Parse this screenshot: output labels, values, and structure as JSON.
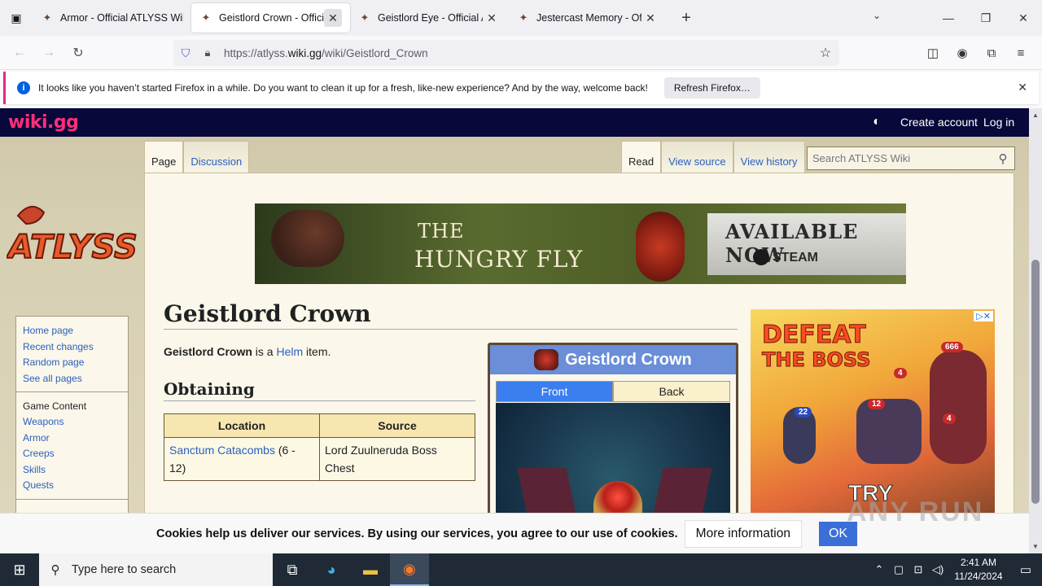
{
  "browser": {
    "tabs": [
      {
        "title": "Armor - Official ATLYSS Wiki",
        "active": false
      },
      {
        "title": "Geistlord Crown - Official ATLYSS Wiki",
        "active": true
      },
      {
        "title": "Geistlord Eye - Official ATLYSS Wiki",
        "active": false
      },
      {
        "title": "Jestercast Memory - Official ATLYSS Wiki",
        "active": false
      }
    ],
    "url_prefix": "https://atlyss.",
    "url_domain": "wiki.gg",
    "url_path": "/wiki/Geistlord_Crown",
    "notification": "It looks like you haven’t started Firefox in a while. Do you want to clean it up for a fresh, like-new experience? And by the way, welcome back!",
    "refresh_label": "Refresh Firefox…"
  },
  "wiki": {
    "brand": "wiki.gg",
    "create_account": "Create account",
    "login": "Log in",
    "logo_text": "ATLYSS",
    "tabs_left": [
      "Page",
      "Discussion"
    ],
    "tabs_right": [
      "Read",
      "View source",
      "View history"
    ],
    "search_placeholder": "Search ATLYSS Wiki",
    "sidebar": {
      "nav": [
        "Home page",
        "Recent changes",
        "Random page",
        "See all pages"
      ],
      "group_title": "Game Content",
      "group_items": [
        "Weapons",
        "Armor",
        "Creeps",
        "Skills",
        "Quests"
      ]
    },
    "banner": {
      "line1": "THE",
      "line2": "HUNGRY FLY",
      "available": "AVAILABLE NOW",
      "steam": "STEAM"
    },
    "page_title": "Geistlord Crown",
    "intro_bold": "Geistlord Crown",
    "intro_mid": " is a ",
    "intro_link": "Helm",
    "intro_end": " item.",
    "section_obtaining": "Obtaining",
    "table": {
      "headers": [
        "Location",
        "Source"
      ],
      "row_location_link": "Sanctum Catacombs",
      "row_location_extra": " (6 - 12)",
      "row_source": "Lord Zuulneruda Boss Chest"
    },
    "infobox": {
      "title": "Geistlord Crown",
      "front": "Front",
      "back": "Back"
    },
    "ad": {
      "line1": "DEFEAT",
      "line2": "THE BOSS",
      "try": "TRY",
      "n1": "666",
      "n2": "4",
      "n3": "12",
      "n4": "4",
      "n5": "22"
    }
  },
  "cookie": {
    "text": "Cookies help us deliver our services. By using our services, you agree to our use of cookies.",
    "more": "More information",
    "ok": "OK"
  },
  "watermark": "ANY RUN",
  "taskbar": {
    "search_placeholder": "Type here to search",
    "time": "2:41 AM",
    "date": "11/24/2024"
  }
}
